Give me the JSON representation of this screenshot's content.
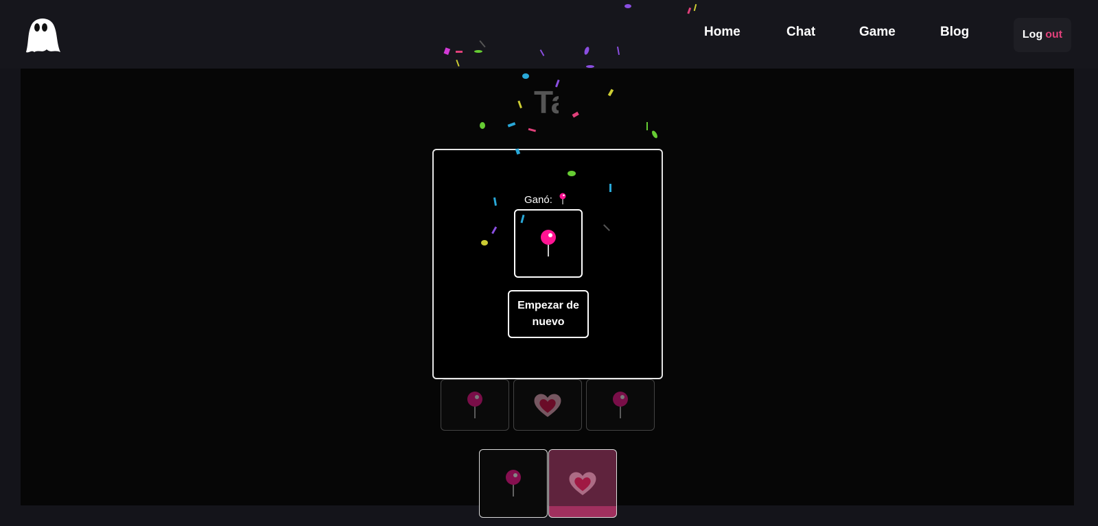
{
  "nav": {
    "logo_icon": "ghost-icon",
    "links": [
      "Home",
      "Chat",
      "Game",
      "Blog"
    ],
    "logout_part1": "Log",
    "logout_part2": "out",
    "accent_color": "#e0407a"
  },
  "game": {
    "title_visible": "Ta",
    "winner_label": "Ganó:",
    "winner_icon": "lollipop-icon",
    "restart_label": "Empezar de nuevo",
    "board_cards": [
      "lollipop-icon",
      "heart-icon",
      "lollipop-icon"
    ],
    "hand_cards": [
      "lollipop-icon",
      "heart-icon"
    ],
    "selected_hand_index": 1,
    "colors": {
      "lollipop": "#ff1493",
      "heart": "#e0407a",
      "selected_card": "#a0305e"
    }
  }
}
